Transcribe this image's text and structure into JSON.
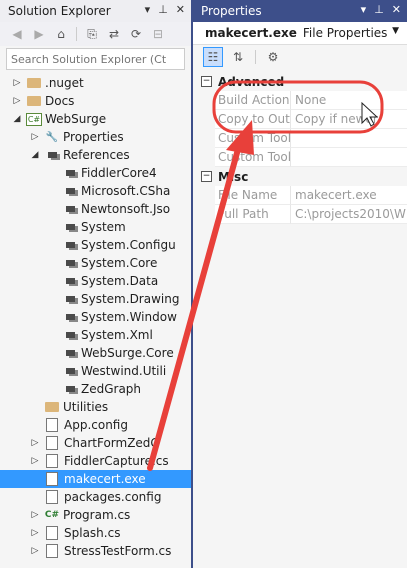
{
  "solution_explorer": {
    "title": "Solution Explorer",
    "search_placeholder": "Search Solution Explorer (Ct",
    "items": [
      {
        "label": ".nuget",
        "expander": "▷",
        "icon": "folder-icon"
      },
      {
        "label": "Docs",
        "expander": "▷",
        "icon": "folder-icon"
      },
      {
        "label": "WebSurge",
        "expander": "◢",
        "icon": "csharp-project-icon"
      },
      {
        "label": "Properties",
        "expander": "▷",
        "icon": "wrench-icon"
      },
      {
        "label": "References",
        "expander": "◢",
        "icon": "references-icon"
      },
      {
        "label": "FiddlerCore4",
        "expander": "",
        "icon": "reference-icon"
      },
      {
        "label": "Microsoft.CSha",
        "expander": "",
        "icon": "reference-icon"
      },
      {
        "label": "Newtonsoft.Jso",
        "expander": "",
        "icon": "reference-icon"
      },
      {
        "label": "System",
        "expander": "",
        "icon": "reference-icon"
      },
      {
        "label": "System.Configu",
        "expander": "",
        "icon": "reference-icon"
      },
      {
        "label": "System.Core",
        "expander": "",
        "icon": "reference-icon"
      },
      {
        "label": "System.Data",
        "expander": "",
        "icon": "reference-icon"
      },
      {
        "label": "System.Drawing",
        "expander": "",
        "icon": "reference-icon"
      },
      {
        "label": "System.Window",
        "expander": "",
        "icon": "reference-icon"
      },
      {
        "label": "System.Xml",
        "expander": "",
        "icon": "reference-icon"
      },
      {
        "label": "WebSurge.Core",
        "expander": "",
        "icon": "reference-icon"
      },
      {
        "label": "Westwind.Utili",
        "expander": "",
        "icon": "reference-icon"
      },
      {
        "label": "ZedGraph",
        "expander": "",
        "icon": "reference-icon"
      },
      {
        "label": "Utilities",
        "expander": "",
        "icon": "folder-icon"
      },
      {
        "label": "App.config",
        "expander": "",
        "icon": "config-file-icon"
      },
      {
        "label": "ChartFormZedG",
        "expander": "▷",
        "icon": "form-file-icon"
      },
      {
        "label": "FiddlerCapture.cs",
        "expander": "▷",
        "icon": "form-file-icon"
      },
      {
        "label": "makecert.exe",
        "expander": "",
        "icon": "exe-file-icon",
        "selected": true
      },
      {
        "label": "packages.config",
        "expander": "",
        "icon": "config-file-icon"
      },
      {
        "label": "Program.cs",
        "expander": "▷",
        "icon": "csharp-file-icon"
      },
      {
        "label": "Splash.cs",
        "expander": "▷",
        "icon": "form-file-icon"
      },
      {
        "label": "StressTestForm.cs",
        "expander": "▷",
        "icon": "form-file-icon"
      }
    ]
  },
  "properties": {
    "title": "Properties",
    "object_name": "makecert.exe",
    "object_type": "File Properties",
    "categories": [
      {
        "name": "Advanced",
        "rows": [
          {
            "name": "Build Action",
            "value": "None"
          },
          {
            "name": "Copy to Outp",
            "value": "Copy if newer"
          },
          {
            "name": "Custom Tool",
            "value": ""
          },
          {
            "name": "Custom Tool",
            "value": ""
          }
        ]
      },
      {
        "name": "Misc",
        "rows": [
          {
            "name": "File Name",
            "value": "makecert.exe"
          },
          {
            "name": "Full Path",
            "value": "C:\\projects2010\\W"
          }
        ]
      }
    ]
  },
  "annotation": {
    "color": "#e8403a"
  }
}
